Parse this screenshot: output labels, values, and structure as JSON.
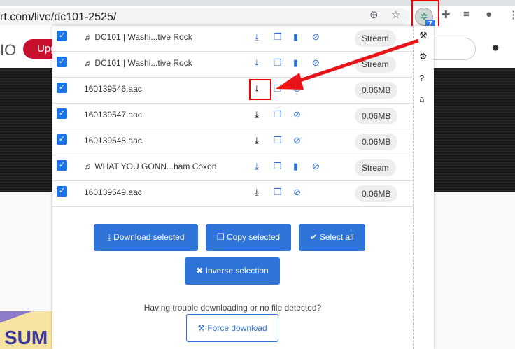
{
  "browser": {
    "url": "rt.com/live/dc101-2525/",
    "extension_badge": "7"
  },
  "page": {
    "logo_fragment": "IO",
    "upgrade_fragment": "Upg",
    "promo_fragment": "SUM"
  },
  "popup": {
    "rows": [
      {
        "name": "♬ DC101 | Washi...tive Rock",
        "type": "Stream",
        "icon_color": "blue",
        "checked": true
      },
      {
        "name": "♬ DC101 | Washi...tive Rock",
        "type": "Stream",
        "icon_color": "blue",
        "checked": true
      },
      {
        "name": "160139546.aac",
        "type": "0.06MB",
        "icon_color": "black",
        "checked": true
      },
      {
        "name": "160139547.aac",
        "type": "0.06MB",
        "icon_color": "black",
        "checked": true
      },
      {
        "name": "160139548.aac",
        "type": "0.06MB",
        "icon_color": "black",
        "checked": true
      },
      {
        "name": "♬ WHAT YOU GONN...ham Coxon",
        "type": "Stream",
        "icon_color": "blue",
        "checked": true
      },
      {
        "name": "160139549.aac",
        "type": "0.06MB",
        "icon_color": "black",
        "checked": true
      }
    ],
    "buttons": {
      "download_selected": "Download selected",
      "copy_selected": "Copy selected",
      "select_all": "Select all",
      "inverse_selection": "Inverse selection"
    },
    "trouble_text": "Having trouble downloading or no file detected?",
    "force_download": "Force download",
    "accent": "#2f74d9"
  }
}
